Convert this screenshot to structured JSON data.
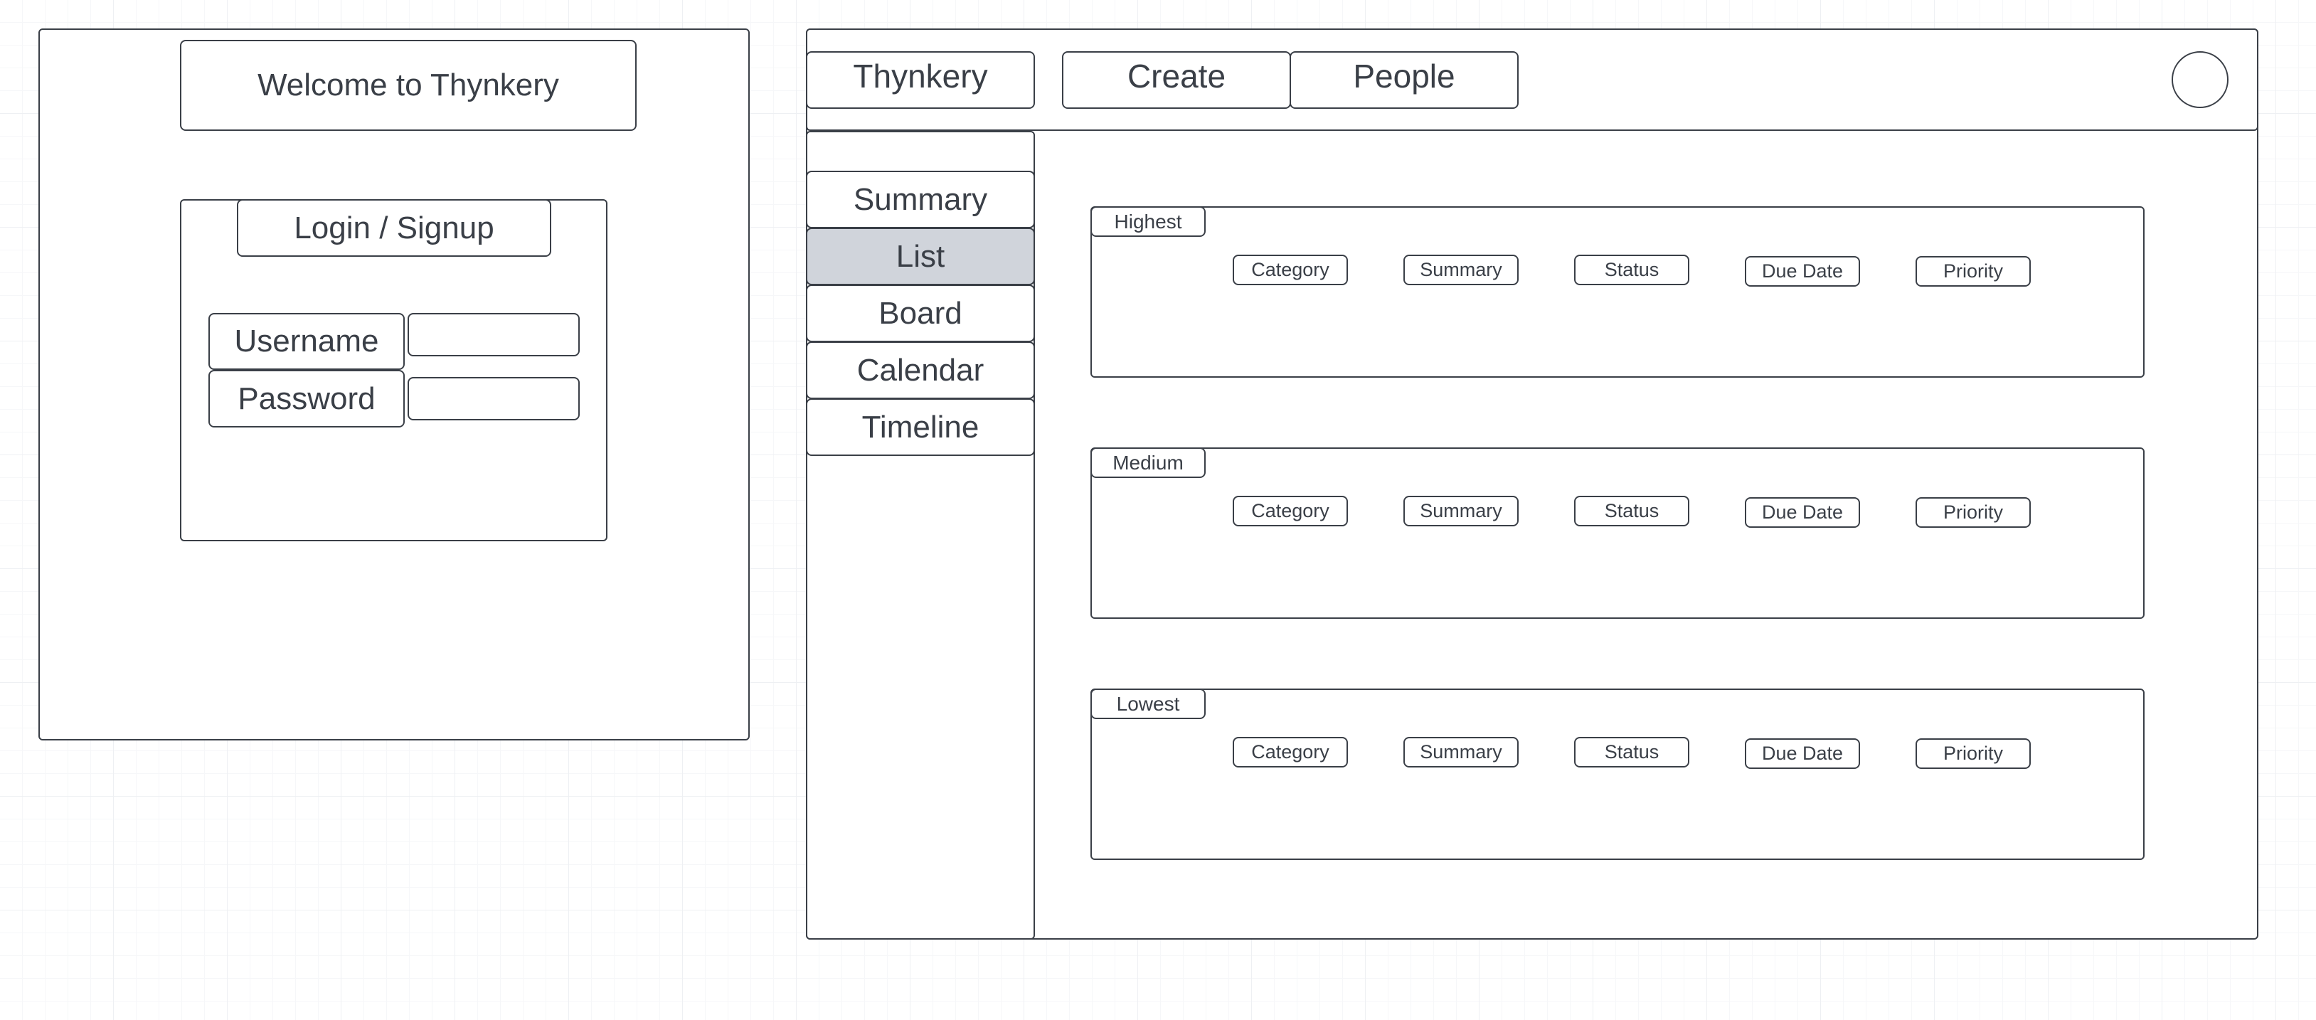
{
  "login": {
    "welcome": "Welcome to Thynkery",
    "title": "Login / Signup",
    "username_label": "Username",
    "password_label": "Password",
    "username_value": "",
    "password_value": ""
  },
  "app": {
    "nav": {
      "brand": "Thynkery",
      "create": "Create",
      "people": "People"
    },
    "sidebar": {
      "items": [
        {
          "label": "Summary",
          "active": false
        },
        {
          "label": "List",
          "active": true
        },
        {
          "label": "Board",
          "active": false
        },
        {
          "label": "Calendar",
          "active": false
        },
        {
          "label": "Timeline",
          "active": false
        }
      ]
    },
    "groups": [
      {
        "title": "Highest",
        "columns": [
          "Category",
          "Summary",
          "Status",
          "Due Date",
          "Priority"
        ]
      },
      {
        "title": "Medium",
        "columns": [
          "Category",
          "Summary",
          "Status",
          "Due Date",
          "Priority"
        ]
      },
      {
        "title": "Lowest",
        "columns": [
          "Category",
          "Summary",
          "Status",
          "Due Date",
          "Priority"
        ]
      }
    ]
  },
  "colors": {
    "stroke": "#3a3f47",
    "active_fill": "#d0d4db",
    "grid": "#eef0f3"
  }
}
